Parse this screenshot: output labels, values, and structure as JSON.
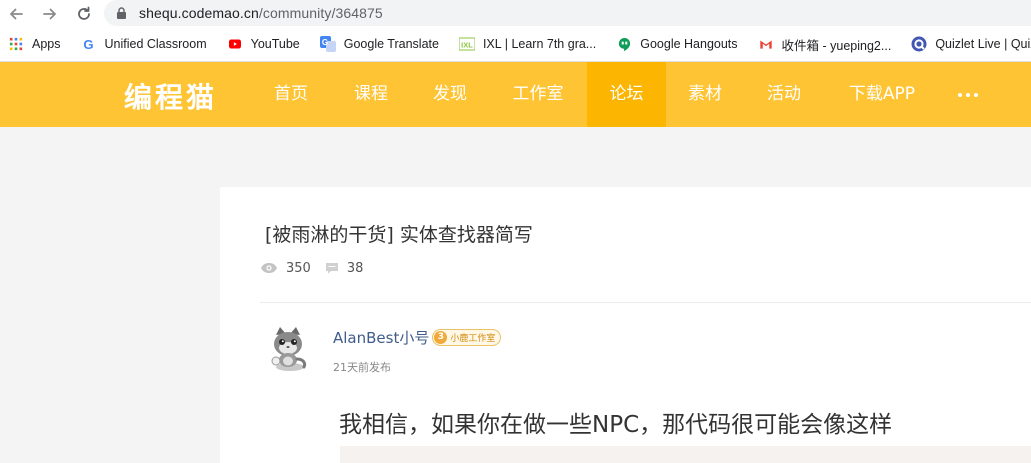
{
  "browser": {
    "url_host": "shequ.codemao.cn",
    "url_path": "/community/364875"
  },
  "bookmarks": [
    {
      "label": "Apps",
      "icon": "apps-grid-icon"
    },
    {
      "label": "Unified Classroom",
      "icon": "google-g-icon"
    },
    {
      "label": "YouTube",
      "icon": "youtube-icon"
    },
    {
      "label": "Google Translate",
      "icon": "google-translate-icon"
    },
    {
      "label": "IXL | Learn 7th gra...",
      "icon": "ixl-icon"
    },
    {
      "label": "Google Hangouts",
      "icon": "hangouts-icon"
    },
    {
      "label": "收件箱 - yueping2...",
      "icon": "gmail-icon"
    },
    {
      "label": "Quizlet Live | Quiz...",
      "icon": "quizlet-icon"
    }
  ],
  "header": {
    "logo": "编程猫",
    "nav": [
      "首页",
      "课程",
      "发现",
      "工作室",
      "论坛",
      "素材",
      "活动",
      "下载APP"
    ],
    "active_nav": "论坛",
    "brand_color": "#fec433",
    "active_color": "#fcb500"
  },
  "post": {
    "title": "[被雨淋的干货] 实体查找器简写",
    "views": "350",
    "comments": "38",
    "author": "AlanBest小号",
    "badge_level": "3",
    "badge_text": "小鹿工作室",
    "time": "21天前发布",
    "body": "我相信，如果你在做一些NPC，那代码很可能会像这样"
  }
}
